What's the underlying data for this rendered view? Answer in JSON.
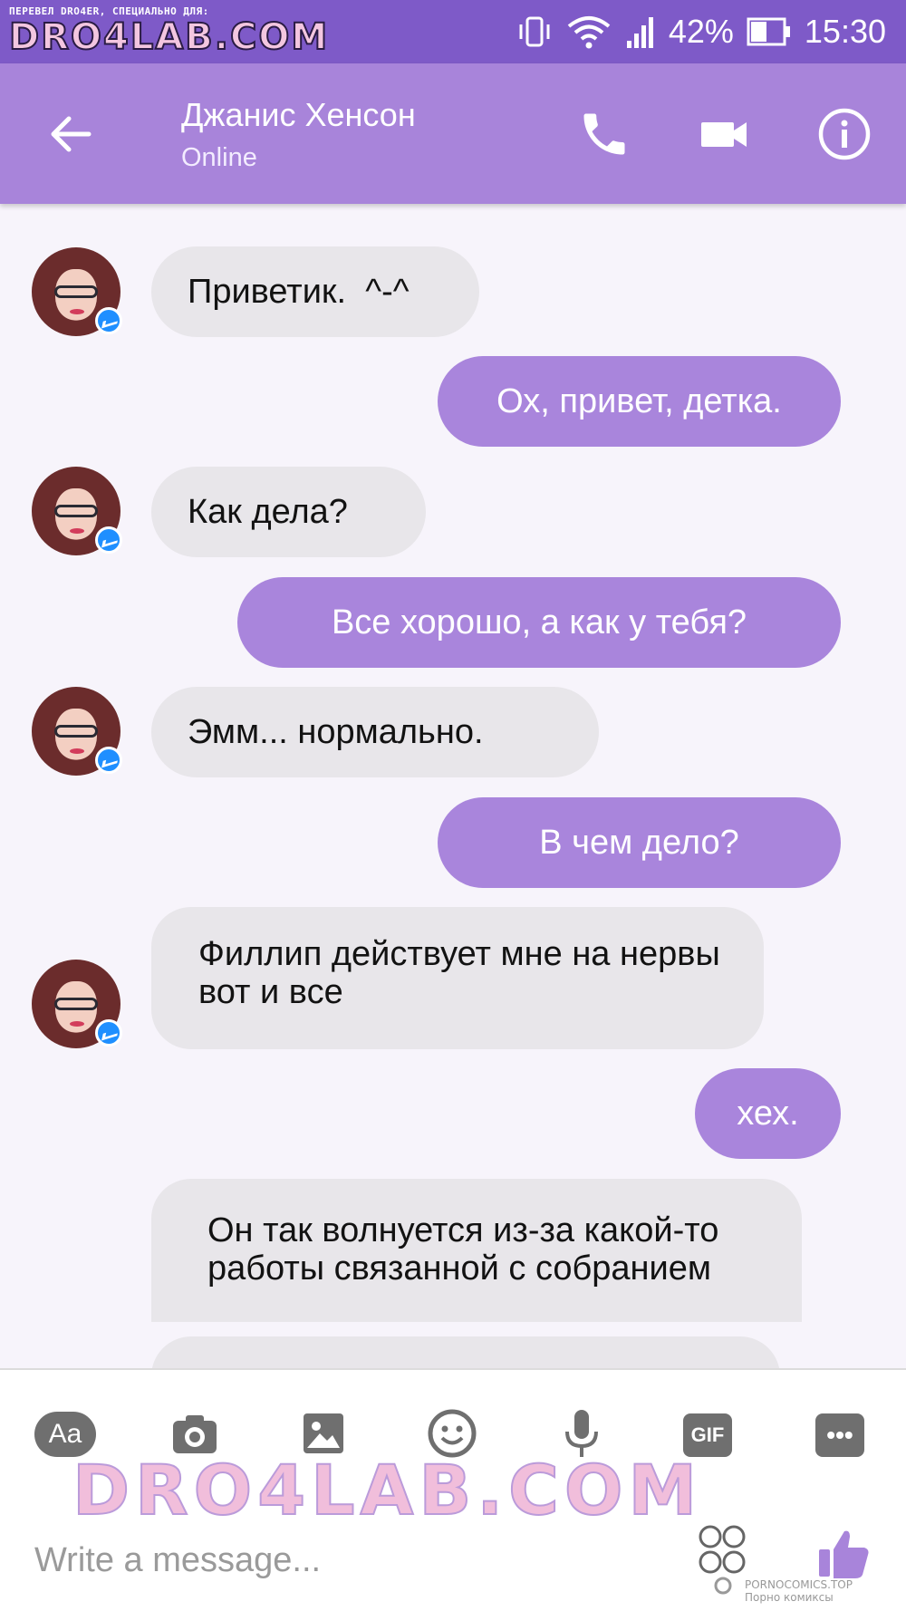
{
  "status_bar": {
    "watermark_caption": "ПЕРЕВЕЛ DRO4ER, СПЕЦИАЛЬНО ДЛЯ:",
    "watermark_logo": "DRO4LAB.COM",
    "battery": "42%",
    "time": "15:30",
    "icons": [
      "vibrate-icon",
      "wifi-icon",
      "signal-icon",
      "battery-icon"
    ]
  },
  "header": {
    "name": "Джанис Хенсон",
    "status": "Online",
    "icons": [
      "back-arrow-icon",
      "phone-icon",
      "video-icon",
      "info-icon"
    ]
  },
  "messages": [
    {
      "dir": "in",
      "text": "Приветик.  ^-^"
    },
    {
      "dir": "out",
      "text": "Ох, привет, детка."
    },
    {
      "dir": "in",
      "text": "Как дела?"
    },
    {
      "dir": "out",
      "text": "Все хорошо, а как у тебя?"
    },
    {
      "dir": "in",
      "text": "Эмм... нормально."
    },
    {
      "dir": "out",
      "text": "В чем дело?"
    },
    {
      "dir": "in",
      "text": "Филлип действует мне на нервы вот и все"
    },
    {
      "dir": "out",
      "text": "хех."
    },
    {
      "dir": "in",
      "text": "Он так волнуется из-за какой-то работы связанной с собранием"
    }
  ],
  "composer": {
    "aa_label": "Aa",
    "gif_label": "GIF",
    "more_label": "•••",
    "placeholder": "Write a message...",
    "watermark_logo": "DRO4LAB.COM",
    "site_tag_line1": "PORNOCOMICS.TOP",
    "site_tag_line2": "Порно комиксы",
    "icons": [
      "camera-icon",
      "gallery-icon",
      "emoji-icon",
      "microphone-icon",
      "emoji-picker-icon",
      "thumbs-up-icon"
    ]
  },
  "colors": {
    "status_bar": "#7e5ac8",
    "header": "#a884da",
    "outgoing_bubble": "#a985dc",
    "incoming_bubble": "#e8e6ea",
    "background": "#f7f4fb"
  }
}
